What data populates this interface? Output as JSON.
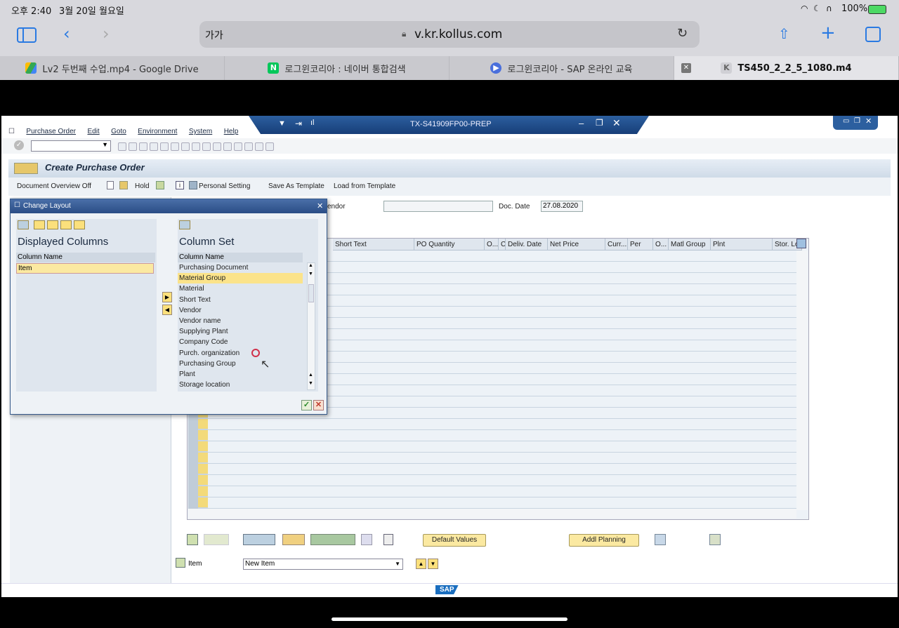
{
  "status": {
    "time": "오후 2:40",
    "date": "3월 20일 월요일",
    "battery": "100%"
  },
  "browser": {
    "text_size": "가가",
    "url": "v.kr.kollus.com"
  },
  "tabs": [
    {
      "label": "Lv2 두번째 수업.mp4 - Google Drive",
      "icon": "google-drive-icon",
      "color": "#4285f4"
    },
    {
      "label": "로그윈코리아 : 네이버 통합검색",
      "icon": "naver-icon",
      "color": "#03c75a",
      "glyph": "N"
    },
    {
      "label": "로그윈코리아 - SAP 온라인 교육",
      "icon": "play-icon",
      "color": "#4a6fdc"
    },
    {
      "label": "TS450_2_2_5_1080.m4",
      "icon": "kollus-icon",
      "color": "#d0d0d5",
      "glyph": "K"
    }
  ],
  "sap": {
    "system": "TX-S41909FP00-PREP",
    "menu": [
      "Purchase Order",
      "Edit",
      "Goto",
      "Environment",
      "System",
      "Help"
    ],
    "title": "Create Purchase Order",
    "app_toolbar": {
      "doc_overview": "Document Overview Off",
      "hold": "Hold",
      "personal_setting": "Personal Setting",
      "save_template": "Save As Template",
      "load_template": "Load from Template"
    },
    "header": {
      "vendor_label": "endor",
      "docdate_label": "Doc. Date",
      "docdate_value": "27.08.2020"
    },
    "columns": [
      "Short Text",
      "PO Quantity",
      "O...",
      "C",
      "Deliv. Date",
      "Net Price",
      "Curr...",
      "Per",
      "O...",
      "Matl Group",
      "Plnt",
      "Stor. Lo"
    ],
    "buttons": {
      "default_values": "Default Values",
      "addl_planning": "Addl Planning"
    },
    "item_label": "Item",
    "item_select": "New Item",
    "logo": "SAP"
  },
  "dialog": {
    "title": "Change Layout",
    "displayed_heading": "Displayed Columns",
    "set_heading": "Column Set",
    "col_header": "Column Name",
    "displayed": [
      "Item"
    ],
    "column_set": [
      "Purchasing Document",
      "Material Group",
      "Material",
      "Short Text",
      "Vendor",
      "Vendor name",
      "Supplying Plant",
      "Company Code",
      "Purch. organization",
      "Purchasing Group",
      "Plant",
      "Storage location"
    ],
    "selected": "Material Group"
  }
}
